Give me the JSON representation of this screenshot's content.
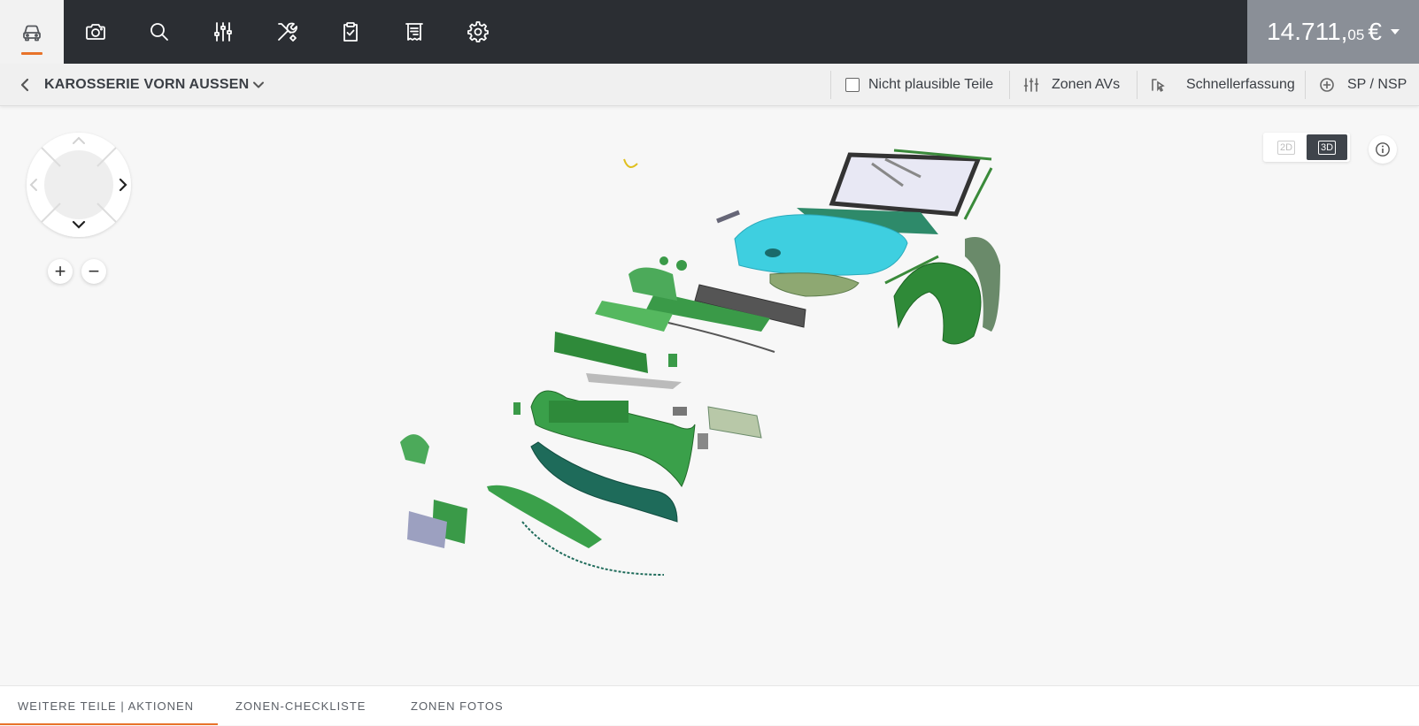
{
  "nav": {
    "items": [
      {
        "name": "car-icon",
        "active": true
      },
      {
        "name": "camera-icon",
        "active": false
      },
      {
        "name": "search-icon",
        "active": false
      },
      {
        "name": "sliders-icon",
        "active": false
      },
      {
        "name": "tools-icon",
        "active": false
      },
      {
        "name": "clipboard-check-icon",
        "active": false
      },
      {
        "name": "receipt-icon",
        "active": false
      },
      {
        "name": "gear-icon",
        "active": false
      }
    ],
    "accent_color": "#e8732a"
  },
  "price": {
    "main": "14.711,",
    "cents": "05",
    "currency": "€"
  },
  "zone": {
    "title": "KAROSSERIE VORN AUSSEN"
  },
  "toolbar": {
    "implausible_label": "Nicht plausible Teile",
    "implausible_checked": false,
    "zones_av_label": "Zonen AVs",
    "quick_capture_label": "Schnellerfassung",
    "sp_nsp_label": "SP / NSP"
  },
  "view": {
    "label_2d": "2D",
    "label_3d": "3D",
    "active": "3D"
  },
  "tabs": {
    "more_parts": "WEITERE TEILE | AKTIONEN",
    "zone_checklist": "ZONEN-CHECKLISTE",
    "zone_photos": "ZONEN FOTOS"
  }
}
